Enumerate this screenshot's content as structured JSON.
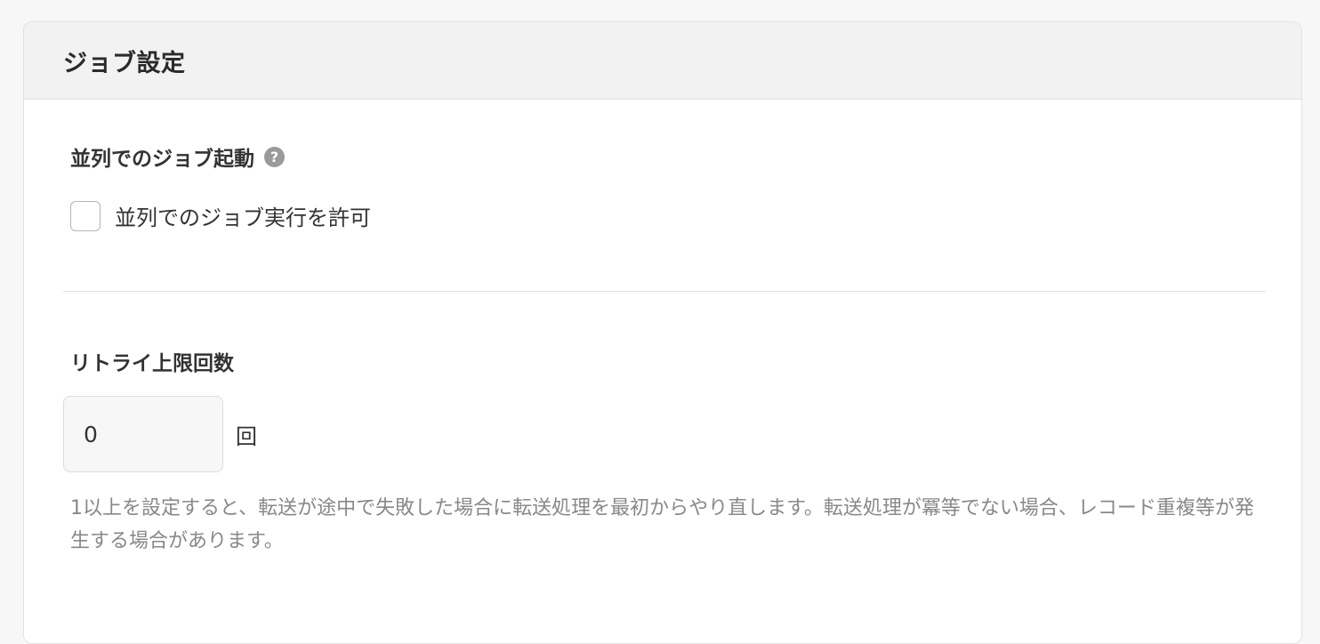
{
  "card": {
    "title": "ジョブ設定"
  },
  "parallel": {
    "title": "並列でのジョブ起動",
    "help_icon": "question-circle-icon",
    "help_glyph": "?",
    "checkbox_label": "並列でのジョブ実行を許可",
    "checked": false
  },
  "retry": {
    "title": "リトライ上限回数",
    "value": "0",
    "unit": "回",
    "help_text": "1以上を設定すると、転送が途中で失敗した場合に転送処理を最初からやり直します。転送処理が冪等でない場合、レコード重複等が発生する場合があります。"
  },
  "colors": {
    "header_bg": "#f2f2f2",
    "help_icon_bg": "#9a9a9a",
    "muted_text": "#888888"
  }
}
